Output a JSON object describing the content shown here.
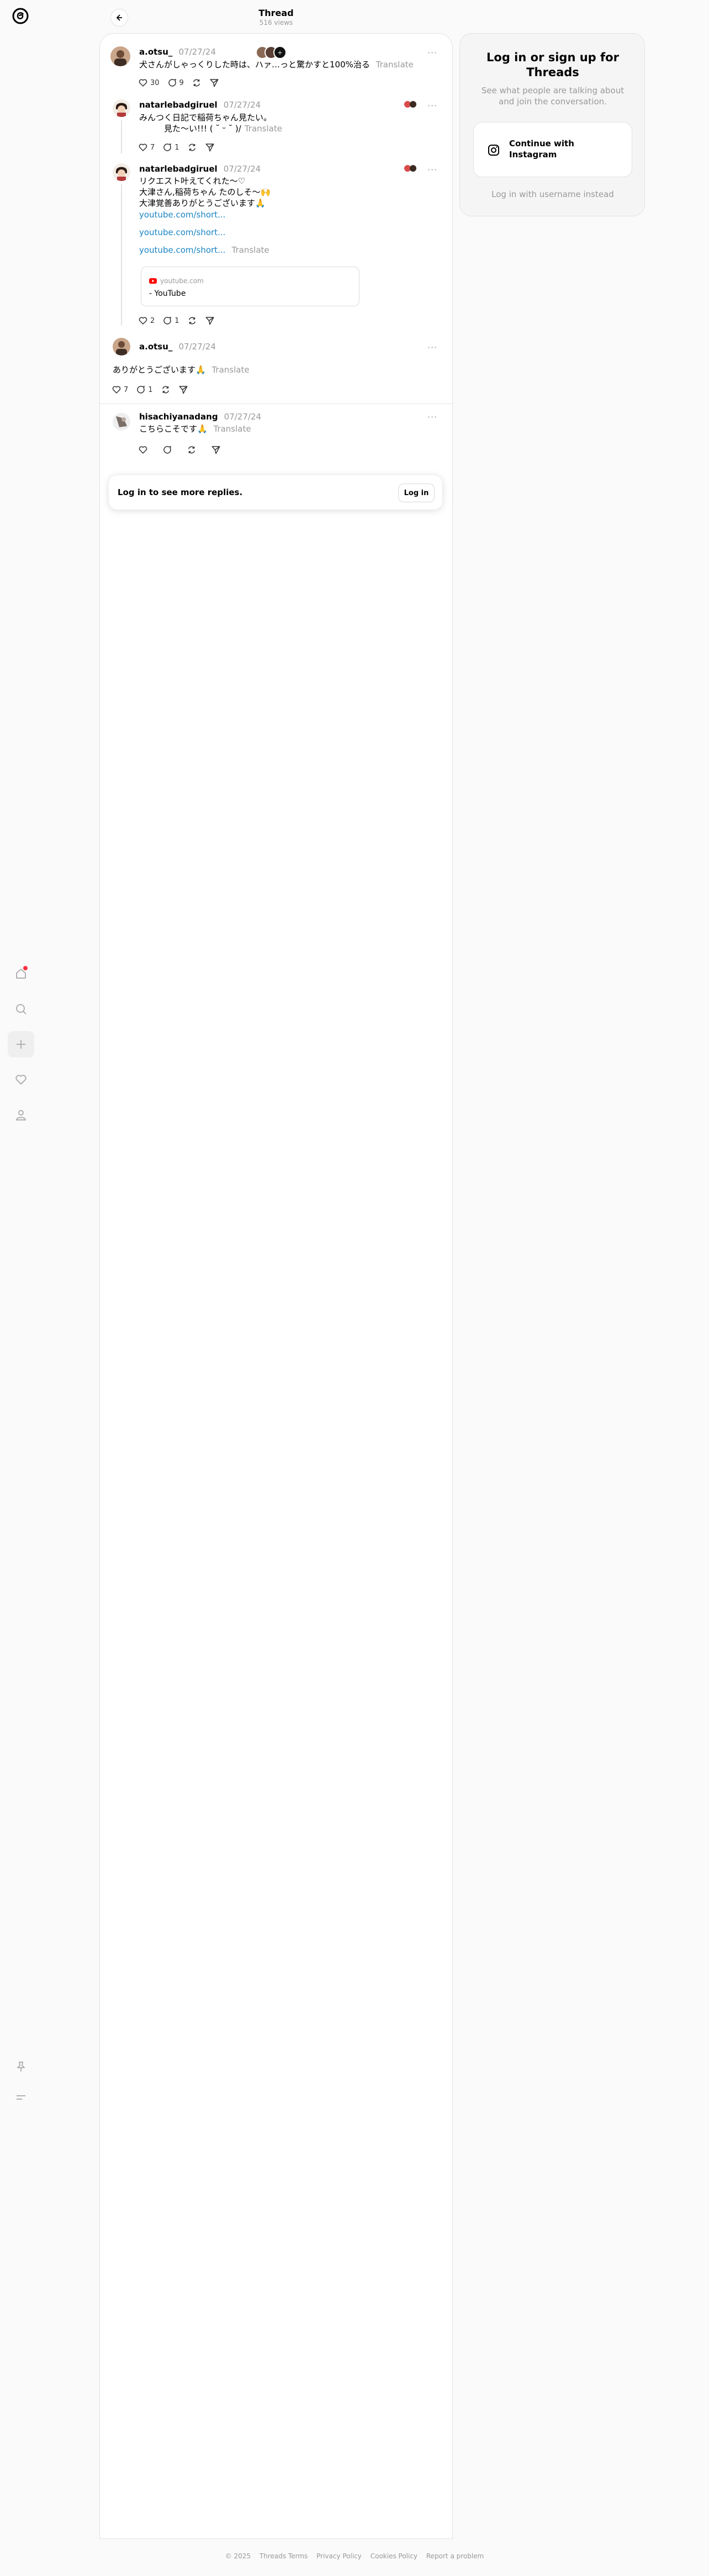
{
  "header": {
    "title": "Thread",
    "views": "516 views"
  },
  "posts": [
    {
      "username": "a.otsu_",
      "time": "07/27/24",
      "text": "犬さんがしゃっくりした時は、ハァ…っと驚かすと100%治る",
      "translate": "Translate",
      "likes": "30",
      "replies": "9",
      "reposts": "",
      "shares": ""
    },
    {
      "username": "natarlebadgiruel",
      "time": "07/27/24",
      "text_line1": "みんつく日記で稲荷ちゃん見たい。",
      "text_line2": "　　　見た〜い!!! (  ˘ ᵕ ˘ )/",
      "translate": "Translate",
      "likes": "7",
      "replies": "1",
      "reposts": "",
      "shares": ""
    },
    {
      "username": "natarlebadgiruel",
      "time": "07/27/24",
      "text_line1": "リクエスト叶えてくれた〜♡",
      "text_line2": "大津さん,稲荷ちゃん たのしそ〜🙌",
      "text_line3": "大津覚善ありがとうございます🙏",
      "link1": "youtube.com/short...",
      "link2": "youtube.com/short...",
      "link3": "youtube.com/short...",
      "translate": "Translate",
      "card_domain": "youtube.com",
      "card_title": "- YouTube",
      "likes": "2",
      "replies": "1",
      "reposts": "",
      "shares": ""
    },
    {
      "username": "a.otsu_",
      "time": "07/27/24",
      "text": "ありがとうございます🙏",
      "translate": "Translate",
      "likes": "7",
      "replies": "1",
      "reposts": "",
      "shares": ""
    },
    {
      "username": "hisachiyanadang",
      "time": "07/27/24",
      "text": "こちらこそです🙏",
      "translate": "Translate",
      "likes": "",
      "replies": "",
      "reposts": "",
      "shares": ""
    }
  ],
  "login_prompt": {
    "text": "Log in to see more replies.",
    "button": "Log in"
  },
  "auth": {
    "title": "Log in or sign up for Threads",
    "subtitle": "See what people are talking about and join the conversation.",
    "instagram_button": "Continue with Instagram",
    "alt_login": "Log in with username instead"
  },
  "footer": {
    "copyright": "© 2025",
    "terms": "Threads Terms",
    "privacy": "Privacy Policy",
    "cookies": "Cookies Policy",
    "report": "Report a problem"
  },
  "icons": {
    "logo": "threads-logo-icon",
    "nav": [
      "home-icon",
      "search-icon",
      "plus-icon",
      "heart-icon",
      "profile-icon",
      "pin-icon",
      "menu-icon"
    ],
    "actions": [
      "heart-icon",
      "comment-icon",
      "repost-icon",
      "share-icon"
    ]
  },
  "colors": {
    "link": "#1a85c4",
    "notification": "#ff3040",
    "muted": "#999999"
  }
}
